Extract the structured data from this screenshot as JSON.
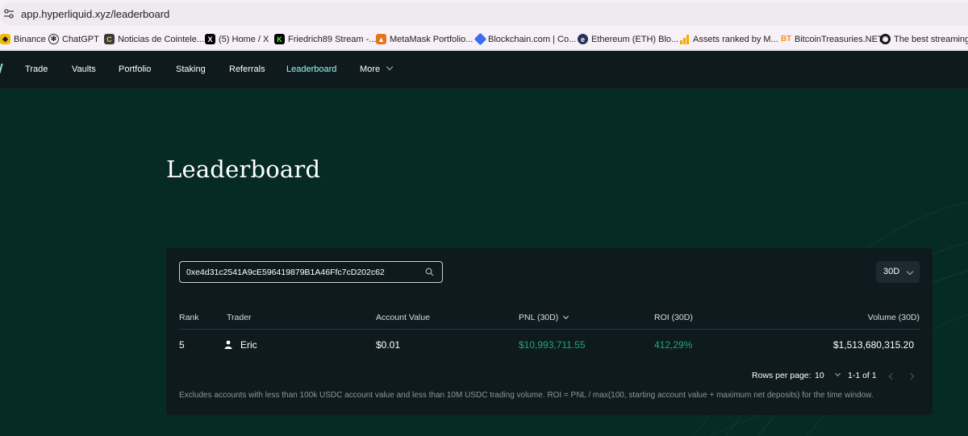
{
  "browser": {
    "url": "app.hyperliquid.xyz/leaderboard",
    "bookmarks": [
      {
        "label": "Binance",
        "icon": "binance-icon",
        "color": "#f0b90b"
      },
      {
        "label": "ChatGPT",
        "icon": "chatgpt-icon",
        "color": "#222222"
      },
      {
        "label": "Noticias de Cointele...",
        "icon": "cointelegraph-icon",
        "color": "#3a3a3a"
      },
      {
        "label": "(5) Home / X",
        "icon": "x-icon",
        "color": "#000000"
      },
      {
        "label": "Friedrich89 Stream -...",
        "icon": "kick-icon",
        "color": "#53fc18"
      },
      {
        "label": "MetaMask Portfolio...",
        "icon": "metamask-icon",
        "color": "#e2761b"
      },
      {
        "label": "Blockchain.com | Co...",
        "icon": "blockchain-icon",
        "color": "#3c6df0"
      },
      {
        "label": "Ethereum (ETH) Blo...",
        "icon": "etherscan-icon",
        "color": "#21325b"
      },
      {
        "label": "Assets ranked by M...",
        "icon": "ranking-icon",
        "color": "#f2a900"
      },
      {
        "label": "BitcoinTreasuries.NET",
        "icon": "bitcointreasuries-icon",
        "color": "#f7931a"
      },
      {
        "label": "The best streaming...",
        "icon": "streaming-icon",
        "color": "#111111"
      }
    ]
  },
  "nav": {
    "items": [
      "Trade",
      "Vaults",
      "Portfolio",
      "Staking",
      "Referrals",
      "Leaderboard",
      "More"
    ],
    "active": "Leaderboard"
  },
  "page": {
    "title": "Leaderboard"
  },
  "leaderboard": {
    "search_value": "0xe4d31c2541A9cE596419879B1A46Ffc7cD202c62",
    "period": "30D",
    "columns": {
      "rank": "Rank",
      "trader": "Trader",
      "account_value": "Account Value",
      "pnl": "PNL (30D)",
      "roi": "ROI (30D)",
      "volume": "Volume (30D)"
    },
    "rows": [
      {
        "rank": "5",
        "trader": "Eric",
        "account_value": "$0.01",
        "pnl": "$10,993,711.55",
        "roi": "412,29%",
        "volume": "$1,513,680,315.20"
      }
    ],
    "pagination": {
      "rows_per_page_label": "Rows per page:",
      "rows_per_page": "10",
      "range": "1-1 of 1"
    },
    "footnote": "Excludes accounts with less than 100k USDC account value and less than 10M USDC trading volume. ROI = PNL / max(100, starting account value + maximum net deposits) for the time window."
  },
  "colors": {
    "background": "#052b24",
    "panel": "#0f1a1f",
    "accent": "#97fce4",
    "positive": "#1fa67d"
  }
}
